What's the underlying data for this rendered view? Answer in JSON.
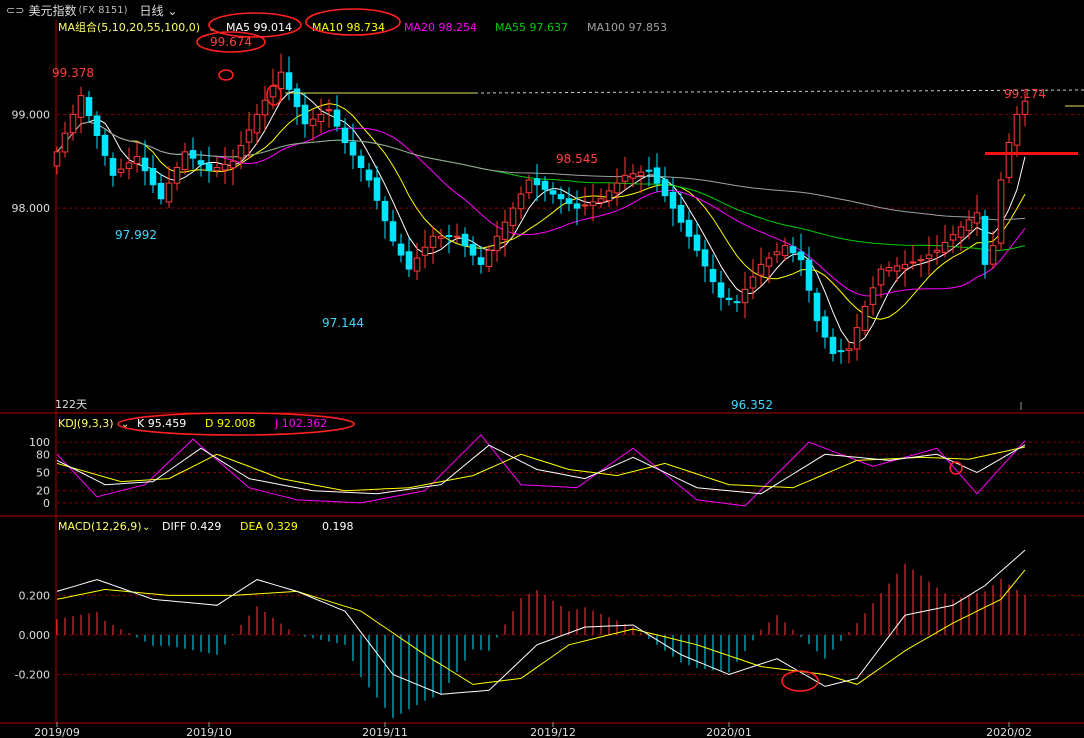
{
  "header": {
    "title": "美元指数",
    "code": "(FX 8151)",
    "period": "日线",
    "link_icon": "link-icon",
    "dropdown_icon": "chevron-down-icon"
  },
  "ma_legend": {
    "group_label": "MA组合(5,10,20,55,100,0)",
    "items": [
      {
        "text": "MA5 99.014",
        "color": "#ffffff"
      },
      {
        "text": "MA10 98.734",
        "color": "#ffff00"
      },
      {
        "text": "MA20 98.254",
        "color": "#ff00ff"
      },
      {
        "text": "MA55 97.637",
        "color": "#00cc00"
      },
      {
        "text": "MA100 97.853",
        "color": "#a0a0a0"
      }
    ]
  },
  "kdj_legend": {
    "label": "KDJ(9,3,3)",
    "items": [
      {
        "text": "K 95.459",
        "color": "#ffffff"
      },
      {
        "text": "D 92.008",
        "color": "#ffff00"
      },
      {
        "text": "J 102.362",
        "color": "#ff00ff"
      }
    ]
  },
  "macd_legend": {
    "label": "MACD(12,26,9)",
    "items": [
      {
        "text": "DIFF 0.429",
        "color": "#ffffff"
      },
      {
        "text": "DEA 0.329",
        "color": "#ffff00"
      },
      {
        "text": "0.198",
        "color": "#ffffff"
      }
    ]
  },
  "bars_count_label": "122天",
  "colors": {
    "up": "#ff3b3b",
    "down": "#00e5ff",
    "grid": "#8b0000",
    "axis_text": "#dddddd",
    "ann": "#ff2020",
    "background": "#000000"
  },
  "chart_data": [
    {
      "type": "candlestick",
      "title": "美元指数 (FX 8151) 日线",
      "x_ticks": [
        "2019/09",
        "2019/10",
        "2019/11",
        "2019/12",
        "2020/01",
        "2020/02"
      ],
      "y_ticks": [
        "99.000",
        "98.000"
      ],
      "ylim": [
        95.9,
        99.9
      ],
      "annotations": [
        {
          "text": "99.378",
          "color": "#ff4040"
        },
        {
          "text": "97.992",
          "color": "#40d8ff"
        },
        {
          "text": "99.674",
          "color": "#ff4040"
        },
        {
          "text": "97.144",
          "color": "#40d8ff"
        },
        {
          "text": "98.545",
          "color": "#ff4040"
        },
        {
          "text": "96.352",
          "color": "#40d8ff"
        },
        {
          "text": "99.174",
          "color": "#ff4040"
        }
      ],
      "waypoints": [
        {
          "i": 0,
          "v": 98.6
        },
        {
          "i": 3,
          "v": 99.2
        },
        {
          "i": 7,
          "v": 98.35
        },
        {
          "i": 10,
          "v": 98.55
        },
        {
          "i": 13,
          "v": 98.1
        },
        {
          "i": 16,
          "v": 98.6
        },
        {
          "i": 19,
          "v": 98.4
        },
        {
          "i": 22,
          "v": 98.5
        },
        {
          "i": 25,
          "v": 99.0
        },
        {
          "i": 28,
          "v": 99.45
        },
        {
          "i": 31,
          "v": 98.9
        },
        {
          "i": 34,
          "v": 99.05
        },
        {
          "i": 36,
          "v": 98.7
        },
        {
          "i": 39,
          "v": 98.3
        },
        {
          "i": 42,
          "v": 97.65
        },
        {
          "i": 44,
          "v": 97.35
        },
        {
          "i": 47,
          "v": 97.7
        },
        {
          "i": 50,
          "v": 97.7
        },
        {
          "i": 53,
          "v": 97.4
        },
        {
          "i": 56,
          "v": 97.85
        },
        {
          "i": 59,
          "v": 98.3
        },
        {
          "i": 62,
          "v": 98.15
        },
        {
          "i": 65,
          "v": 98.0
        },
        {
          "i": 68,
          "v": 98.1
        },
        {
          "i": 71,
          "v": 98.35
        },
        {
          "i": 74,
          "v": 98.4
        },
        {
          "i": 77,
          "v": 98.0
        },
        {
          "i": 80,
          "v": 97.55
        },
        {
          "i": 83,
          "v": 97.05
        },
        {
          "i": 85,
          "v": 97.0
        },
        {
          "i": 88,
          "v": 97.4
        },
        {
          "i": 91,
          "v": 97.6
        },
        {
          "i": 93,
          "v": 97.45
        },
        {
          "i": 95,
          "v": 96.8
        },
        {
          "i": 97,
          "v": 96.45
        },
        {
          "i": 99,
          "v": 96.5
        },
        {
          "i": 101,
          "v": 96.95
        },
        {
          "i": 103,
          "v": 97.35
        },
        {
          "i": 106,
          "v": 97.4
        },
        {
          "i": 108,
          "v": 97.45
        },
        {
          "i": 110,
          "v": 97.55
        },
        {
          "i": 113,
          "v": 97.8
        },
        {
          "i": 115,
          "v": 97.95
        },
        {
          "i": 116,
          "v": 97.4
        },
        {
          "i": 117,
          "v": 97.6
        },
        {
          "i": 118,
          "v": 98.3
        },
        {
          "i": 119,
          "v": 98.7
        },
        {
          "i": 120,
          "v": 99.0
        },
        {
          "i": 121,
          "v": 99.14
        }
      ]
    },
    {
      "type": "line",
      "title": "KDJ(9,3,3)",
      "y_ticks": [
        "100",
        "80",
        "50",
        "20",
        "0"
      ],
      "ylim": [
        -15,
        120
      ],
      "series": [
        {
          "name": "K",
          "color": "#ffffff"
        },
        {
          "name": "D",
          "color": "#ffff00"
        },
        {
          "name": "J",
          "color": "#ff00ff"
        }
      ],
      "k_waypoints": [
        {
          "i": 0,
          "v": 70
        },
        {
          "i": 6,
          "v": 30
        },
        {
          "i": 12,
          "v": 35
        },
        {
          "i": 18,
          "v": 90
        },
        {
          "i": 24,
          "v": 40
        },
        {
          "i": 32,
          "v": 20
        },
        {
          "i": 40,
          "v": 15
        },
        {
          "i": 48,
          "v": 30
        },
        {
          "i": 54,
          "v": 95
        },
        {
          "i": 60,
          "v": 55
        },
        {
          "i": 66,
          "v": 40
        },
        {
          "i": 72,
          "v": 75
        },
        {
          "i": 80,
          "v": 25
        },
        {
          "i": 88,
          "v": 15
        },
        {
          "i": 96,
          "v": 80
        },
        {
          "i": 104,
          "v": 70
        },
        {
          "i": 110,
          "v": 80
        },
        {
          "i": 115,
          "v": 50
        },
        {
          "i": 121,
          "v": 95.459
        }
      ],
      "d_waypoints": [
        {
          "i": 0,
          "v": 65
        },
        {
          "i": 8,
          "v": 35
        },
        {
          "i": 14,
          "v": 40
        },
        {
          "i": 20,
          "v": 80
        },
        {
          "i": 28,
          "v": 40
        },
        {
          "i": 36,
          "v": 20
        },
        {
          "i": 44,
          "v": 25
        },
        {
          "i": 52,
          "v": 45
        },
        {
          "i": 58,
          "v": 80
        },
        {
          "i": 64,
          "v": 55
        },
        {
          "i": 70,
          "v": 45
        },
        {
          "i": 76,
          "v": 65
        },
        {
          "i": 84,
          "v": 30
        },
        {
          "i": 92,
          "v": 25
        },
        {
          "i": 100,
          "v": 70
        },
        {
          "i": 108,
          "v": 75
        },
        {
          "i": 114,
          "v": 72
        },
        {
          "i": 121,
          "v": 92.008
        }
      ],
      "j_waypoints": [
        {
          "i": 0,
          "v": 80
        },
        {
          "i": 5,
          "v": 10
        },
        {
          "i": 11,
          "v": 30
        },
        {
          "i": 17,
          "v": 105
        },
        {
          "i": 24,
          "v": 25
        },
        {
          "i": 30,
          "v": 5
        },
        {
          "i": 38,
          "v": 0
        },
        {
          "i": 46,
          "v": 20
        },
        {
          "i": 53,
          "v": 112
        },
        {
          "i": 58,
          "v": 30
        },
        {
          "i": 65,
          "v": 25
        },
        {
          "i": 72,
          "v": 90
        },
        {
          "i": 80,
          "v": 5
        },
        {
          "i": 86,
          "v": -5
        },
        {
          "i": 94,
          "v": 100
        },
        {
          "i": 102,
          "v": 60
        },
        {
          "i": 110,
          "v": 90
        },
        {
          "i": 115,
          "v": 15
        },
        {
          "i": 121,
          "v": 102.362
        }
      ]
    },
    {
      "type": "bar",
      "title": "MACD(12,26,9)",
      "y_ticks": [
        "0.200",
        "0.000",
        "-0.200"
      ],
      "ylim": [
        -0.42,
        0.48
      ],
      "series": [
        {
          "name": "DIFF",
          "color": "#ffffff"
        },
        {
          "name": "DEA",
          "color": "#ffff00"
        }
      ],
      "diff_waypoints": [
        {
          "i": 0,
          "v": 0.22
        },
        {
          "i": 5,
          "v": 0.28
        },
        {
          "i": 12,
          "v": 0.18
        },
        {
          "i": 20,
          "v": 0.15
        },
        {
          "i": 25,
          "v": 0.28
        },
        {
          "i": 30,
          "v": 0.22
        },
        {
          "i": 36,
          "v": 0.12
        },
        {
          "i": 42,
          "v": -0.2
        },
        {
          "i": 48,
          "v": -0.3
        },
        {
          "i": 54,
          "v": -0.28
        },
        {
          "i": 60,
          "v": -0.05
        },
        {
          "i": 66,
          "v": 0.04
        },
        {
          "i": 72,
          "v": 0.05
        },
        {
          "i": 78,
          "v": -0.1
        },
        {
          "i": 84,
          "v": -0.2
        },
        {
          "i": 90,
          "v": -0.12
        },
        {
          "i": 96,
          "v": -0.26
        },
        {
          "i": 100,
          "v": -0.22
        },
        {
          "i": 106,
          "v": 0.1
        },
        {
          "i": 112,
          "v": 0.15
        },
        {
          "i": 116,
          "v": 0.25
        },
        {
          "i": 121,
          "v": 0.429
        }
      ],
      "dea_waypoints": [
        {
          "i": 0,
          "v": 0.18
        },
        {
          "i": 6,
          "v": 0.23
        },
        {
          "i": 14,
          "v": 0.2
        },
        {
          "i": 22,
          "v": 0.2
        },
        {
          "i": 30,
          "v": 0.22
        },
        {
          "i": 38,
          "v": 0.12
        },
        {
          "i": 46,
          "v": -0.1
        },
        {
          "i": 52,
          "v": -0.25
        },
        {
          "i": 58,
          "v": -0.22
        },
        {
          "i": 64,
          "v": -0.05
        },
        {
          "i": 72,
          "v": 0.03
        },
        {
          "i": 80,
          "v": -0.05
        },
        {
          "i": 88,
          "v": -0.16
        },
        {
          "i": 96,
          "v": -0.2
        },
        {
          "i": 100,
          "v": -0.25
        },
        {
          "i": 106,
          "v": -0.08
        },
        {
          "i": 112,
          "v": 0.06
        },
        {
          "i": 118,
          "v": 0.18
        },
        {
          "i": 121,
          "v": 0.329
        }
      ]
    }
  ]
}
